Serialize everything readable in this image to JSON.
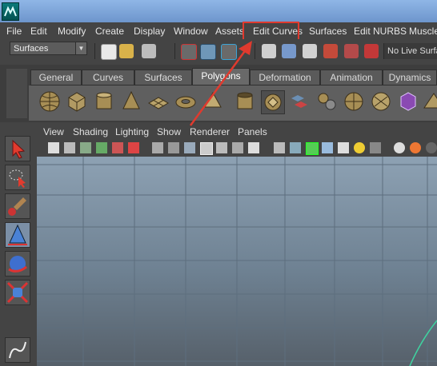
{
  "menubar": {
    "items": [
      "File",
      "Edit",
      "Modify",
      "Create",
      "Display",
      "Window",
      "Assets",
      "Edit Curves",
      "Surfaces",
      "Edit NURBS",
      "Muscle"
    ],
    "highlighted": "Edit Curves"
  },
  "status_line": {
    "mode": "Surfaces",
    "live_surface": "No Live Surface"
  },
  "shelf": {
    "tabs": [
      "General",
      "Curves",
      "Surfaces",
      "Polygons",
      "Deformation",
      "Animation",
      "Dynamics"
    ],
    "active_tab": "Polygons"
  },
  "viewport": {
    "menu": [
      "View",
      "Shading",
      "Lighting",
      "Show",
      "Renderer",
      "Panels"
    ]
  },
  "colors": {
    "highlight_box": "#e03a2e",
    "viewport_top": "#8da1b3",
    "viewport_bottom": "#56606a",
    "grid_line": "#5d6e7e",
    "curve": "#3fd3a0"
  }
}
